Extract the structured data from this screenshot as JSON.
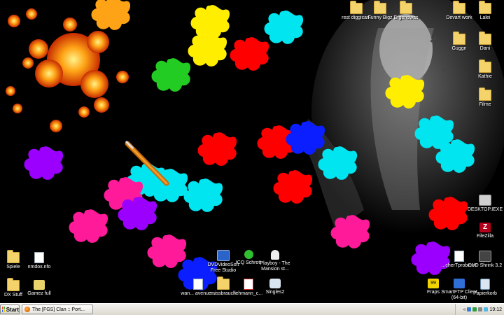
{
  "desktop": {
    "icons_right_top": [
      {
        "label": "rest diggicam",
        "type": "folder"
      },
      {
        "label": "Funny Bigz",
        "type": "folder"
      },
      {
        "label": "Brgendwas",
        "type": "folder"
      },
      {
        "label": "Devart work",
        "type": "folder"
      },
      {
        "label": "Lalei",
        "type": "folder"
      },
      {
        "label": "Guggn",
        "type": "folder"
      },
      {
        "label": "Dani",
        "type": "folder"
      },
      {
        "label": "Kathie",
        "type": "folder"
      },
      {
        "label": "Filme",
        "type": "folder"
      }
    ],
    "icons_right_bottom": [
      {
        "label": "DESKTOP.IEXE",
        "type": "app"
      },
      {
        "label": "FileZilla",
        "type": "app"
      },
      {
        "label": "...cherTprobe.txt",
        "type": "doc"
      },
      {
        "label": "DVD Shrink 3.2",
        "type": "app"
      },
      {
        "label": "Fraps",
        "type": "app"
      },
      {
        "label": "SmartFTP Client (64-bit)",
        "type": "app"
      },
      {
        "label": "Papierkorb",
        "type": "app"
      }
    ],
    "icons_left": [
      {
        "label": "Spiele",
        "type": "folder"
      },
      {
        "label": "nmdox.nfo",
        "type": "doc"
      },
      {
        "label": "DX Stuff",
        "type": "folder"
      },
      {
        "label": "Gamez full",
        "type": "app"
      }
    ],
    "icons_middle": [
      {
        "label": "DVDVideoSoft Free Studio",
        "type": "app"
      },
      {
        "label": "ICQ Schrott",
        "type": "app"
      },
      {
        "label": "Playboy - The Mansion st...",
        "type": "app"
      },
      {
        "label": "wan... avenue...",
        "type": "doc"
      },
      {
        "label": "missbrauch",
        "type": "folder"
      },
      {
        "label": "lehmann_c...",
        "type": "doc"
      },
      {
        "label": "Singles2",
        "type": "app"
      }
    ]
  },
  "taskbar": {
    "start_label": "Start",
    "task_label": "The [FGS] Clan :: Port...",
    "clock": "19:12"
  },
  "colors": {
    "taskbar": "#dcd9cf",
    "splat_yellow": "#ffee00",
    "splat_cyan": "#00e5f0",
    "splat_red": "#ff0000",
    "splat_green": "#22cc22",
    "splat_blue": "#0a1eff",
    "splat_purple": "#9b00ff",
    "splat_magenta": "#ff1a9a"
  }
}
